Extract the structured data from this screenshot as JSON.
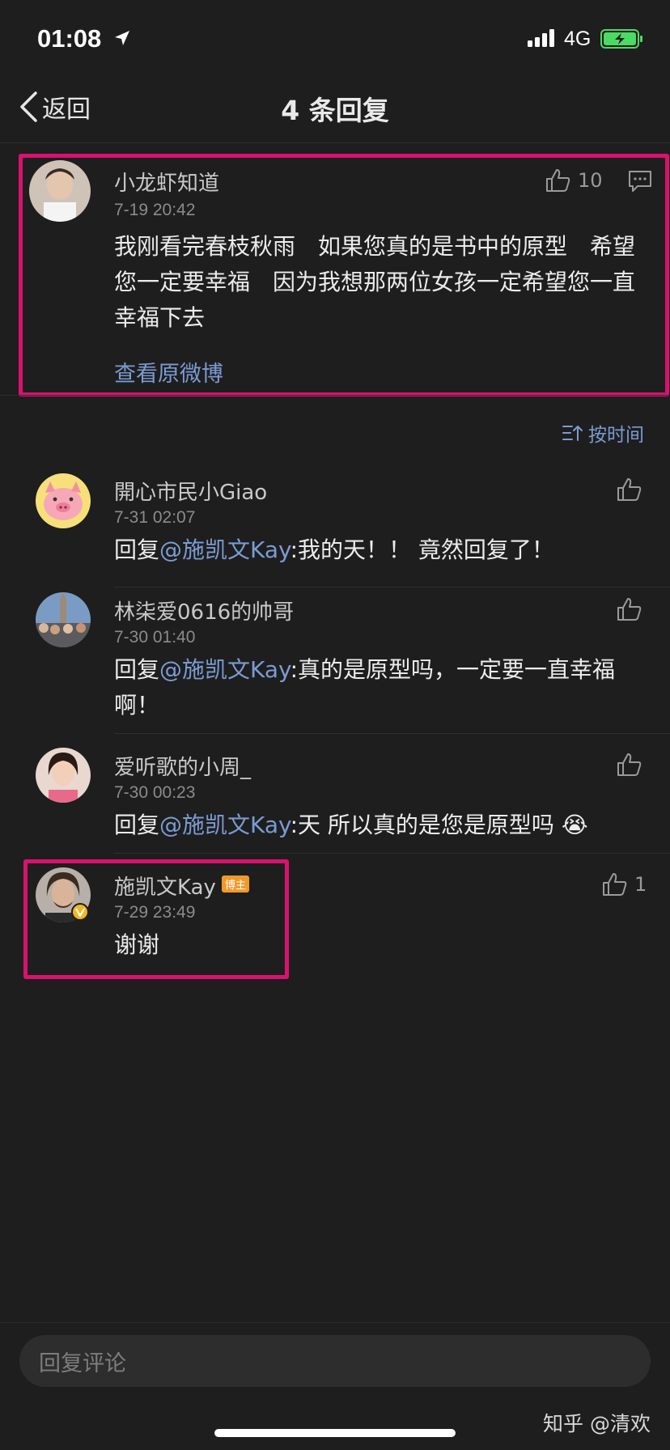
{
  "status": {
    "time": "01:08",
    "network": "4G"
  },
  "nav": {
    "back_label": "返回",
    "title": "4 条回复"
  },
  "main_comment": {
    "username": "小龙虾知道",
    "time": "7-19 20:42",
    "likes": "10",
    "text": "我刚看完春枝秋雨　如果您真的是书中的原型　希望您一定要幸福　因为我想那两位女孩一定希望您一直幸福下去",
    "view_original": "查看原微博"
  },
  "sort_label": "按时间",
  "replies": [
    {
      "username": "開心市民小Giao",
      "time": "7-31 02:07",
      "prefix": "回复",
      "mention": "@施凯文Kay",
      "text": ":我的天！！ 竟然回复了！",
      "likes": ""
    },
    {
      "username": "林柒爱0616的帅哥",
      "time": "7-30 01:40",
      "prefix": "回复",
      "mention": "@施凯文Kay",
      "text": ":真的是原型吗，一定要一直幸福啊！",
      "likes": ""
    },
    {
      "username": "爱听歌的小周_",
      "time": "7-30 00:23",
      "prefix": "回复",
      "mention": "@施凯文Kay",
      "text": ":天 所以真的是您是原型吗 😭",
      "likes": ""
    },
    {
      "username": "施凯文Kay",
      "badge": "博主",
      "time": "7-29 23:49",
      "text": "谢谢",
      "likes": "1"
    }
  ],
  "reply_placeholder": "回复评论",
  "watermark": "知乎 @清欢",
  "colors": {
    "background": "#1e1e1e",
    "highlight": "#d9126f",
    "link": "#7b9bd3",
    "badge": "#f19a2c"
  }
}
